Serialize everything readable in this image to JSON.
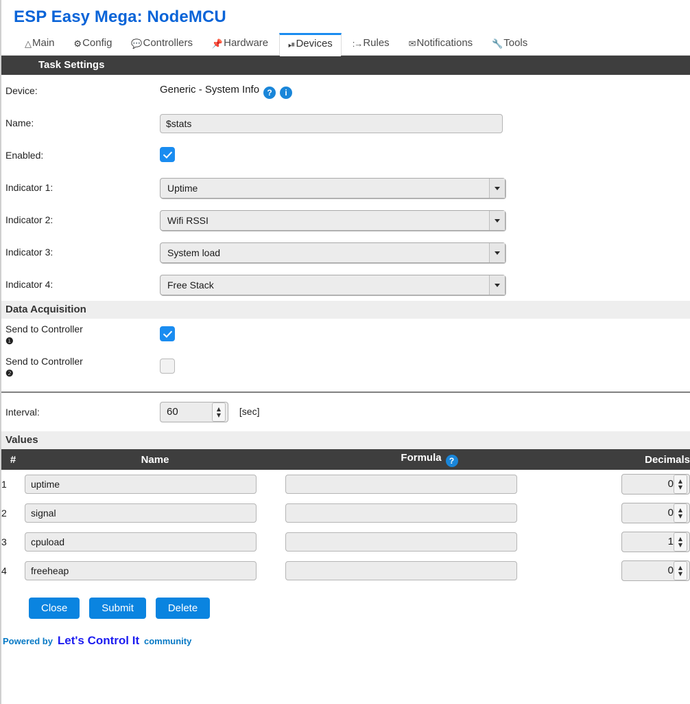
{
  "header": {
    "title": "ESP Easy Mega: NodeMCU"
  },
  "tabs": [
    {
      "label": "Main",
      "icon": "home-icon",
      "active": false
    },
    {
      "label": "Config",
      "icon": "gear-icon",
      "active": false
    },
    {
      "label": "Controllers",
      "icon": "chat-icon",
      "active": false
    },
    {
      "label": "Hardware",
      "icon": "pin-icon",
      "active": false
    },
    {
      "label": "Devices",
      "icon": "plug-icon",
      "active": true
    },
    {
      "label": "Rules",
      "icon": "arrow-icon",
      "active": false
    },
    {
      "label": "Notifications",
      "icon": "mail-icon",
      "active": false
    },
    {
      "label": "Tools",
      "icon": "wrench-icon",
      "active": false
    }
  ],
  "task_settings": {
    "section_title": "Task Settings",
    "device_label": "Device:",
    "device_value": "Generic - System Info",
    "help_badge": "?",
    "info_badge": "i",
    "name_label": "Name:",
    "name_value": "$stats",
    "name_placeholder": "",
    "enabled_label": "Enabled:",
    "enabled_checked": true,
    "indicators": [
      {
        "label": "Indicator 1:",
        "value": "Uptime"
      },
      {
        "label": "Indicator 2:",
        "value": "Wifi RSSI"
      },
      {
        "label": "Indicator 3:",
        "value": "System load"
      },
      {
        "label": "Indicator 4:",
        "value": "Free Stack"
      }
    ]
  },
  "data_acquisition": {
    "section_title": "Data Acquisition",
    "controllers": [
      {
        "label": "Send to Controller",
        "index": "❶",
        "checked": true
      },
      {
        "label": "Send to Controller",
        "index": "❷",
        "checked": false
      }
    ],
    "interval_label": "Interval:",
    "interval_value": "60",
    "interval_unit": "[sec]"
  },
  "values": {
    "section_title": "Values",
    "columns": {
      "num": "#",
      "name": "Name",
      "formula": "Formula",
      "formula_help": "?",
      "decimals": "Decimals"
    },
    "rows": [
      {
        "num": "1",
        "name": "uptime",
        "formula": "",
        "decimals": "0"
      },
      {
        "num": "2",
        "name": "signal",
        "formula": "",
        "decimals": "0"
      },
      {
        "num": "3",
        "name": "cpuload",
        "formula": "",
        "decimals": "1"
      },
      {
        "num": "4",
        "name": "freeheap",
        "formula": "",
        "decimals": "0"
      }
    ]
  },
  "buttons": {
    "close": "Close",
    "submit": "Submit",
    "delete": "Delete"
  },
  "footer": {
    "powered_by": "Powered by",
    "link": "Let's Control It",
    "community": "community"
  },
  "colors": {
    "accent_blue": "#0a84e0",
    "title_blue": "#0a64d8",
    "tab_active": "#1a8cf0",
    "dark_bar": "#3e3e3e",
    "light_bar": "#eeeeee",
    "badge_blue": "#1a86d9",
    "link_blue": "#1c1cf0",
    "footer_blue": "#0779c5"
  }
}
